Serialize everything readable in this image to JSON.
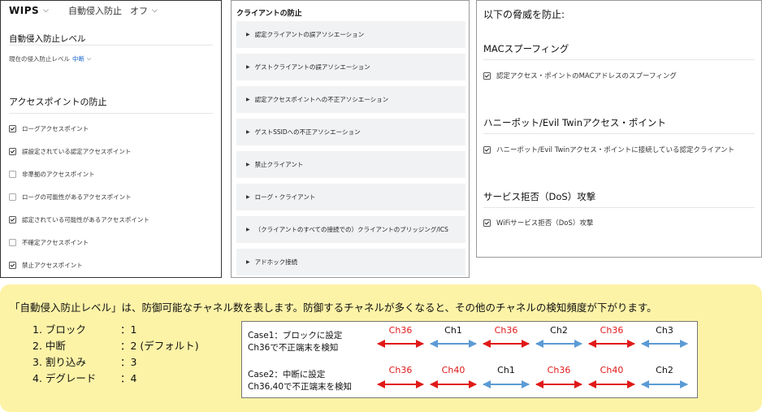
{
  "panel1": {
    "brand": "WIPS",
    "mode_label": "自動侵入防止",
    "mode_value": "オフ",
    "section1_title": "自動侵入防止レベル",
    "level_label": "現在の侵入防止レベル",
    "level_value": "中断",
    "section2_title": "アクセスポイントの防止",
    "checkboxes": [
      {
        "label": "ローグアクセスポイント",
        "checked": true
      },
      {
        "label": "誤設定されている認定アクセスポイント",
        "checked": true
      },
      {
        "label": "非準拠のアクセスポイント",
        "checked": false
      },
      {
        "label": "ローグの可能性があるアクセスポイント",
        "checked": false
      },
      {
        "label": "認定されている可能性があるアクセスポイント",
        "checked": true
      },
      {
        "label": "不確定アクセスポイント",
        "checked": false
      },
      {
        "label": "禁止アクセスポイント",
        "checked": true
      }
    ]
  },
  "panel2": {
    "title": "クライアントの防止",
    "items": [
      "認定クライアントの誤アソシエーション",
      "ゲストクライアントの誤アソシエーション",
      "認定アクセスポイントへの不正アソシエーション",
      "ゲストSSIDへの不正アソシエーション",
      "禁止クライアント",
      "ローグ・クライアント",
      "（クライアントのすべての接続での）クライアントのブリッジング/ICS",
      "アドホック接続"
    ]
  },
  "panel3": {
    "title": "以下の脅威を防止:",
    "sections": [
      {
        "heading": "MACスプーフィング",
        "item": "認定アクセス・ポイントのMACアドレスのスプーフィング",
        "checked": true
      },
      {
        "heading": "ハニーポット/Evil Twinアクセス・ポイント",
        "item": "ハニーポット/Evil Twinアクセス・ポイントに接続している認定クライアント",
        "checked": true
      },
      {
        "heading": "サービス拒否（DoS）攻撃",
        "item": "WiFiサービス拒否（DoS）攻撃",
        "checked": true
      }
    ]
  },
  "note": {
    "text": "「自動侵入防止レベル」は、防御可能なチャネル数を表します。防御するチャネルが多くなると、その他のチャネルの検知頻度が下がります。",
    "levels": [
      {
        "name": "1. ブロック",
        "value": "：1"
      },
      {
        "name": "2. 中断",
        "value": "：2 (デフォルト)"
      },
      {
        "name": "3. 割り込み",
        "value": "：3"
      },
      {
        "name": "4. デグレード",
        "value": "：4"
      }
    ],
    "cases": [
      {
        "line1": "Case1：ブロックに設定",
        "line2": "Ch36で不正端末を検知",
        "channels": [
          {
            "label": "Ch36",
            "color": "#e11919"
          },
          {
            "label": "Ch1",
            "color": "#111111"
          },
          {
            "label": "Ch36",
            "color": "#e11919"
          },
          {
            "label": "Ch2",
            "color": "#111111"
          },
          {
            "label": "Ch36",
            "color": "#e11919"
          },
          {
            "label": "Ch3",
            "color": "#111111"
          }
        ]
      },
      {
        "line1": "Case2：中断に設定",
        "line2": "Ch36,40で不正端末を検知",
        "channels": [
          {
            "label": "Ch36",
            "color": "#e11919"
          },
          {
            "label": "Ch40",
            "color": "#e11919"
          },
          {
            "label": "Ch1",
            "color": "#111111"
          },
          {
            "label": "Ch36",
            "color": "#e11919"
          },
          {
            "label": "Ch40",
            "color": "#e11919"
          },
          {
            "label": "Ch2",
            "color": "#111111"
          }
        ]
      }
    ],
    "arrow_colors": {
      "detect": "#e11919",
      "scan": "#5b9bd5"
    }
  }
}
